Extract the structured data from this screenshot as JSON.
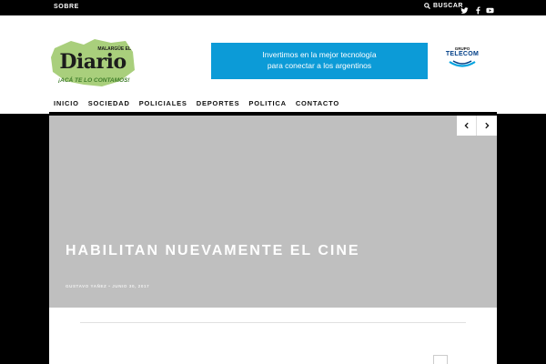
{
  "topbar": {
    "about_label": "SOBRE",
    "search_label": "BUSCAR",
    "social": [
      "twitter-icon",
      "facebook-icon",
      "youtube-icon"
    ]
  },
  "header": {
    "logo": {
      "top_text": "MALARGÜE EL",
      "main_text": "Diario",
      "tagline": "¡ACÁ TE LO CONTAMOS!"
    },
    "banner": {
      "line1": "Invertimos en la mejor tecnología",
      "line2": "para conectar a los argentinos",
      "color": "#0c9bd7"
    },
    "sponsor": {
      "group": "GRUPO",
      "name": "TELECOM"
    }
  },
  "nav": {
    "items": [
      "INICIO",
      "SOCIEDAD",
      "POLICIALES",
      "DEPORTES",
      "POLITICA",
      "CONTACTO"
    ]
  },
  "slider": {
    "title": "HABILITAN NUEVAMENTE EL CINE",
    "meta": "GUSTAVO YAÑEZ • JUNIO 30, 2017"
  }
}
